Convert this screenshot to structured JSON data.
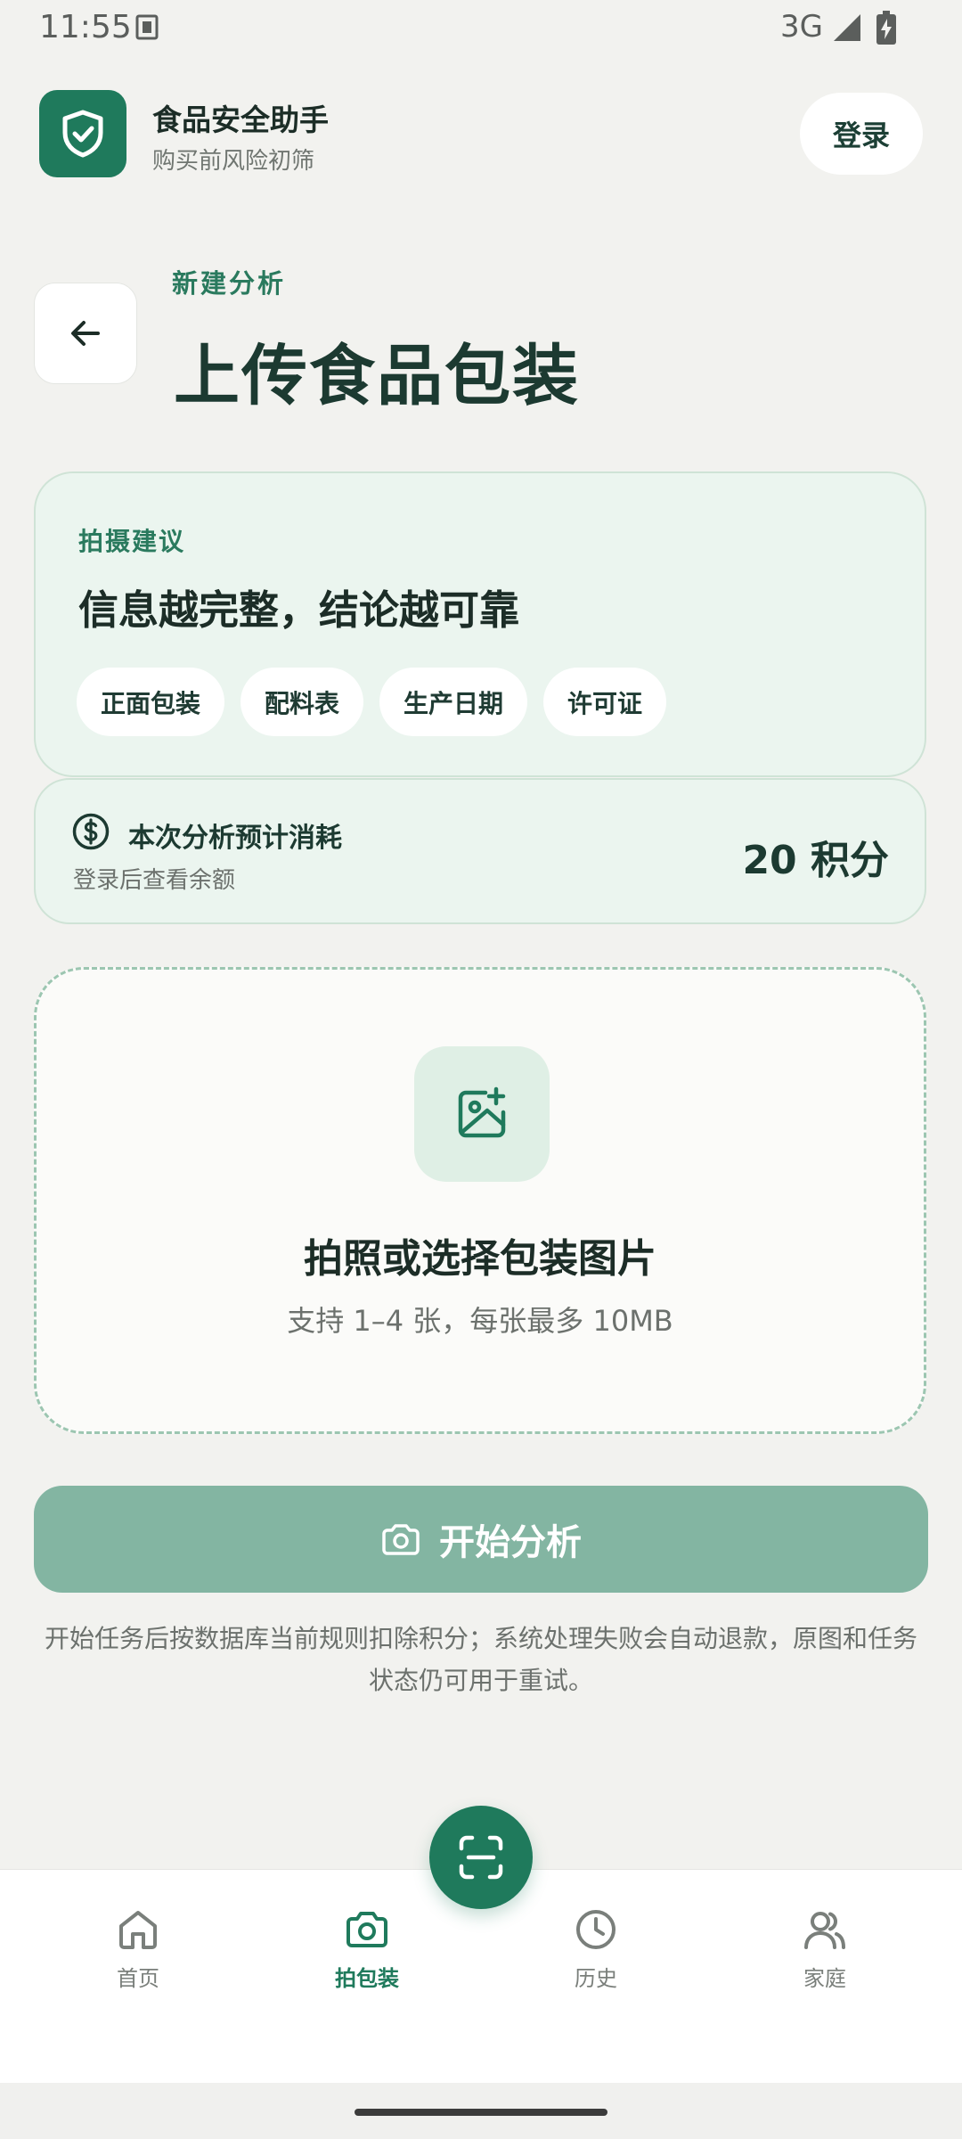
{
  "status_bar": {
    "time": "11:55",
    "network": "3G"
  },
  "header": {
    "title": "食品安全助手",
    "subtitle": "购买前风险初筛",
    "login_label": "登录",
    "logo_icon": "shield-check-icon"
  },
  "page": {
    "eyebrow": "新建分析",
    "title": "上传食品包装"
  },
  "tips": {
    "label": "拍摄建议",
    "heading": "信息越完整，结论越可靠",
    "chips": [
      "正面包装",
      "配料表",
      "生产日期",
      "许可证"
    ]
  },
  "cost": {
    "label": "本次分析预计消耗",
    "sub": "登录后查看余额",
    "amount": "20 积分"
  },
  "upload": {
    "title": "拍照或选择包装图片",
    "hint": "支持 1–4 张，每张最多 10MB"
  },
  "start_button": {
    "label": "开始分析"
  },
  "disclaimer": "开始任务后按数据库当前规则扣除积分；系统处理失败会自动退款，原图和任务状态仍可用于重试。",
  "nav": {
    "items": [
      {
        "label": "首页"
      },
      {
        "label": "拍包装"
      },
      {
        "label": "历史"
      },
      {
        "label": "家庭"
      }
    ],
    "active": "拍包装"
  },
  "colors": {
    "brand": "#1f7a5c",
    "button_disabled": "#83b5a2",
    "card_bg": "#ebf5ef"
  }
}
